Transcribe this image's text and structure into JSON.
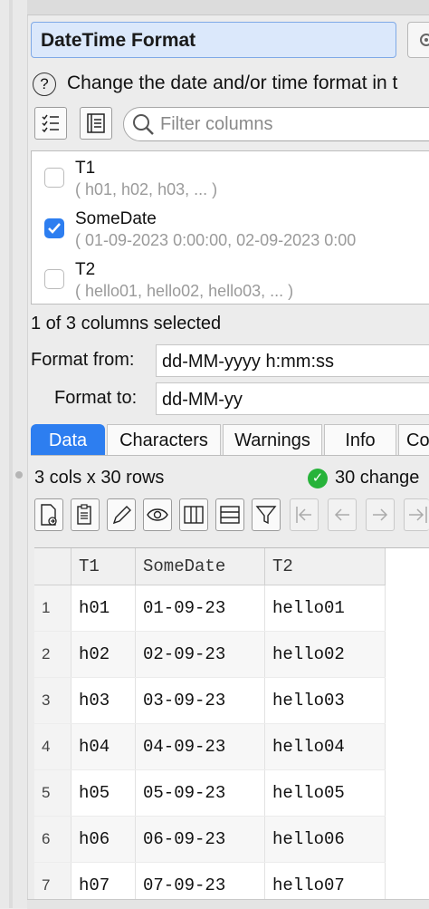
{
  "panel": {
    "title": "DateTime Format",
    "description": "Change the date and/or time format in t"
  },
  "filter": {
    "placeholder": "Filter columns"
  },
  "columns": [
    {
      "name": "T1",
      "sample": "( h01, h02, h03, ... )",
      "checked": false
    },
    {
      "name": "SomeDate",
      "sample": "( 01-09-2023 0:00:00, 02-09-2023 0:00",
      "checked": true
    },
    {
      "name": "T2",
      "sample": "( hello01, hello02, hello03, ... )",
      "checked": false
    }
  ],
  "selection_summary": "1 of 3 columns selected",
  "format_from": {
    "label": "Format from:",
    "value": "dd-MM-yyyy h:mm:ss"
  },
  "format_to": {
    "label": "Format to:",
    "value": "dd-MM-yy"
  },
  "tabs": [
    {
      "label": "Data",
      "active": true
    },
    {
      "label": "Characters",
      "active": false
    },
    {
      "label": "Warnings",
      "active": false
    },
    {
      "label": "Info",
      "active": false
    },
    {
      "label": "Co",
      "active": false
    }
  ],
  "stats": {
    "dims": "3 cols x 30 rows",
    "changes": "30 change"
  },
  "toolbar": [
    "export-icon",
    "paste-icon",
    "pencil-icon",
    "eye-icon",
    "columns-icon",
    "rows-icon",
    "filter-icon",
    "first-icon",
    "prev-icon",
    "next-icon",
    "last-icon"
  ],
  "grid": {
    "headers": [
      "T1",
      "SomeDate",
      "T2"
    ],
    "rows": [
      [
        "1",
        "h01",
        "01-09-23",
        "hello01"
      ],
      [
        "2",
        "h02",
        "02-09-23",
        "hello02"
      ],
      [
        "3",
        "h03",
        "03-09-23",
        "hello03"
      ],
      [
        "4",
        "h04",
        "04-09-23",
        "hello04"
      ],
      [
        "5",
        "h05",
        "05-09-23",
        "hello05"
      ],
      [
        "6",
        "h06",
        "06-09-23",
        "hello06"
      ],
      [
        "7",
        "h07",
        "07-09-23",
        "hello07"
      ]
    ]
  },
  "colors": {
    "accent": "#2d7ef0",
    "title_bg": "#dbe8fb",
    "ok": "#27b33a"
  }
}
